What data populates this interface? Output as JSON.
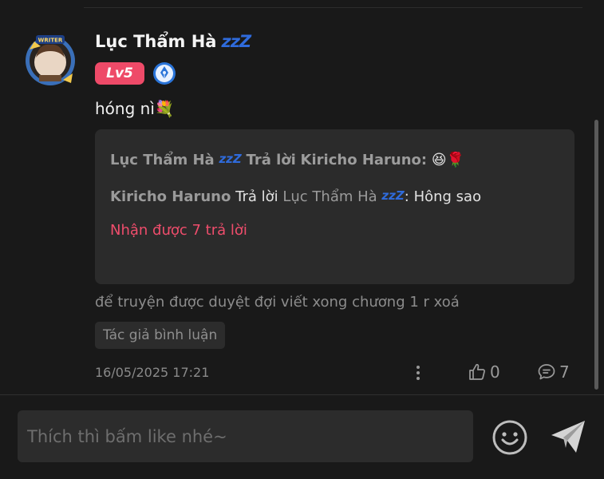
{
  "comment": {
    "user": {
      "name": "Lục Thẩm Hà",
      "name_suffix": "zzZ",
      "avatar_frame_text": "WRITER",
      "level": "Lv5"
    },
    "text": "hóng nì",
    "text_emoji": "💐",
    "replies": [
      {
        "author": "Lục Thẩm Hà",
        "author_suffix": "zzZ",
        "reply_word": "Trả lời",
        "target": "Kiricho Haruno",
        "separator": ":",
        "content": "😆🌹"
      },
      {
        "author": "Kiricho Haruno",
        "reply_word": "Trả lời",
        "target": "Lục Thẩm Hà",
        "target_suffix": "zzZ",
        "separator": ":",
        "content": "Hông sao"
      }
    ],
    "more_replies": "Nhận được 7 trả lời",
    "note": "để truyện được duyệt đợi viết xong chương 1 r xoá",
    "author_tag": "Tác giả bình luận",
    "timestamp": "16/05/2025 17:21",
    "likes": "0",
    "reply_count": "7"
  },
  "input": {
    "placeholder": "Thích thì bấm like nhé~"
  },
  "icons": {
    "more": "more-vertical-icon",
    "like": "thumbs-up-icon",
    "reply": "chat-bubble-icon",
    "emoji": "smiley-icon",
    "send": "send-arrow-icon",
    "level_badge_color": "#ee4a68",
    "accent_blue": "#2f6bdc",
    "link_red": "#ef4d6c"
  }
}
